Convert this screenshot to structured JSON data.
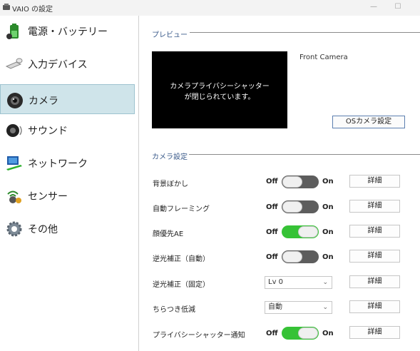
{
  "window": {
    "title": "VAIO の設定",
    "minimize_glyph": "—",
    "maximize_glyph": "☐"
  },
  "sidebar": {
    "items": [
      {
        "label": "電源・バッテリー",
        "icon": "battery-icon",
        "active": false
      },
      {
        "label": "入力デバイス",
        "icon": "keyboard-mouse-icon",
        "active": false
      },
      {
        "label": "カメラ",
        "icon": "camera-icon",
        "active": true
      },
      {
        "label": "サウンド",
        "icon": "speaker-icon",
        "active": false
      },
      {
        "label": "ネットワーク",
        "icon": "network-icon",
        "active": false
      },
      {
        "label": "センサー",
        "icon": "sensor-icon",
        "active": false
      },
      {
        "label": "その他",
        "icon": "gear-icon",
        "active": false
      }
    ]
  },
  "preview": {
    "section_title": "プレビュー",
    "message_line1": "カメラプライバシーシャッター",
    "message_line2": "が閉じられています。",
    "camera_name": "Front Camera",
    "os_settings_button": "OSカメラ設定"
  },
  "camera_settings": {
    "section_title": "カメラ設定",
    "off_label": "Off",
    "on_label": "On",
    "detail_label": "詳細",
    "rows": [
      {
        "label": "背景ぼかし",
        "control": "toggle",
        "state": "off"
      },
      {
        "label": "自動フレーミング",
        "control": "toggle",
        "state": "off"
      },
      {
        "label": "顔優先AE",
        "control": "toggle",
        "state": "on"
      },
      {
        "label": "逆光補正（自動）",
        "control": "toggle",
        "state": "off"
      },
      {
        "label": "逆光補正（固定）",
        "control": "select",
        "value": "Lv 0"
      },
      {
        "label": "ちらつき低減",
        "control": "select",
        "value": "自動"
      },
      {
        "label": "プライバシーシャッター通知",
        "control": "toggle",
        "state": "on"
      }
    ]
  },
  "colors": {
    "toggle_on": "#36c236",
    "toggle_off": "#5d5d5d",
    "active_nav": "#cfe4ea",
    "section_title": "#3a5a8a"
  }
}
